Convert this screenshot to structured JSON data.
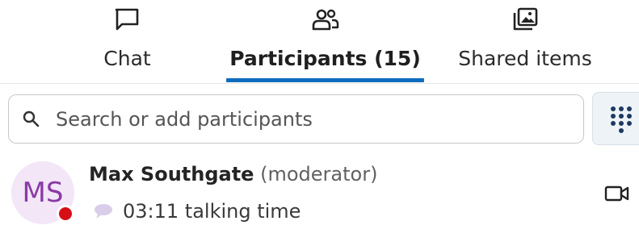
{
  "tabs": [
    {
      "label": "Chat",
      "icon": "chat-icon",
      "active": false
    },
    {
      "label": "Participants (15)",
      "icon": "people-icon",
      "active": true
    },
    {
      "label": "Shared items",
      "icon": "shared-items-icon",
      "active": false
    }
  ],
  "search": {
    "placeholder": "Search or add participants"
  },
  "dialpad": {
    "icon": "dialpad-icon"
  },
  "participants": [
    {
      "initials": "MS",
      "name": "Max Southgate",
      "role": "(moderator)",
      "status_text": "03:11 talking time",
      "presence": "busy",
      "presence_color": "#d70e16",
      "avatar_bg": "#f2e6f7",
      "avatar_fg": "#8a3aa6"
    }
  ],
  "colors": {
    "accent": "#0f6cbd"
  }
}
